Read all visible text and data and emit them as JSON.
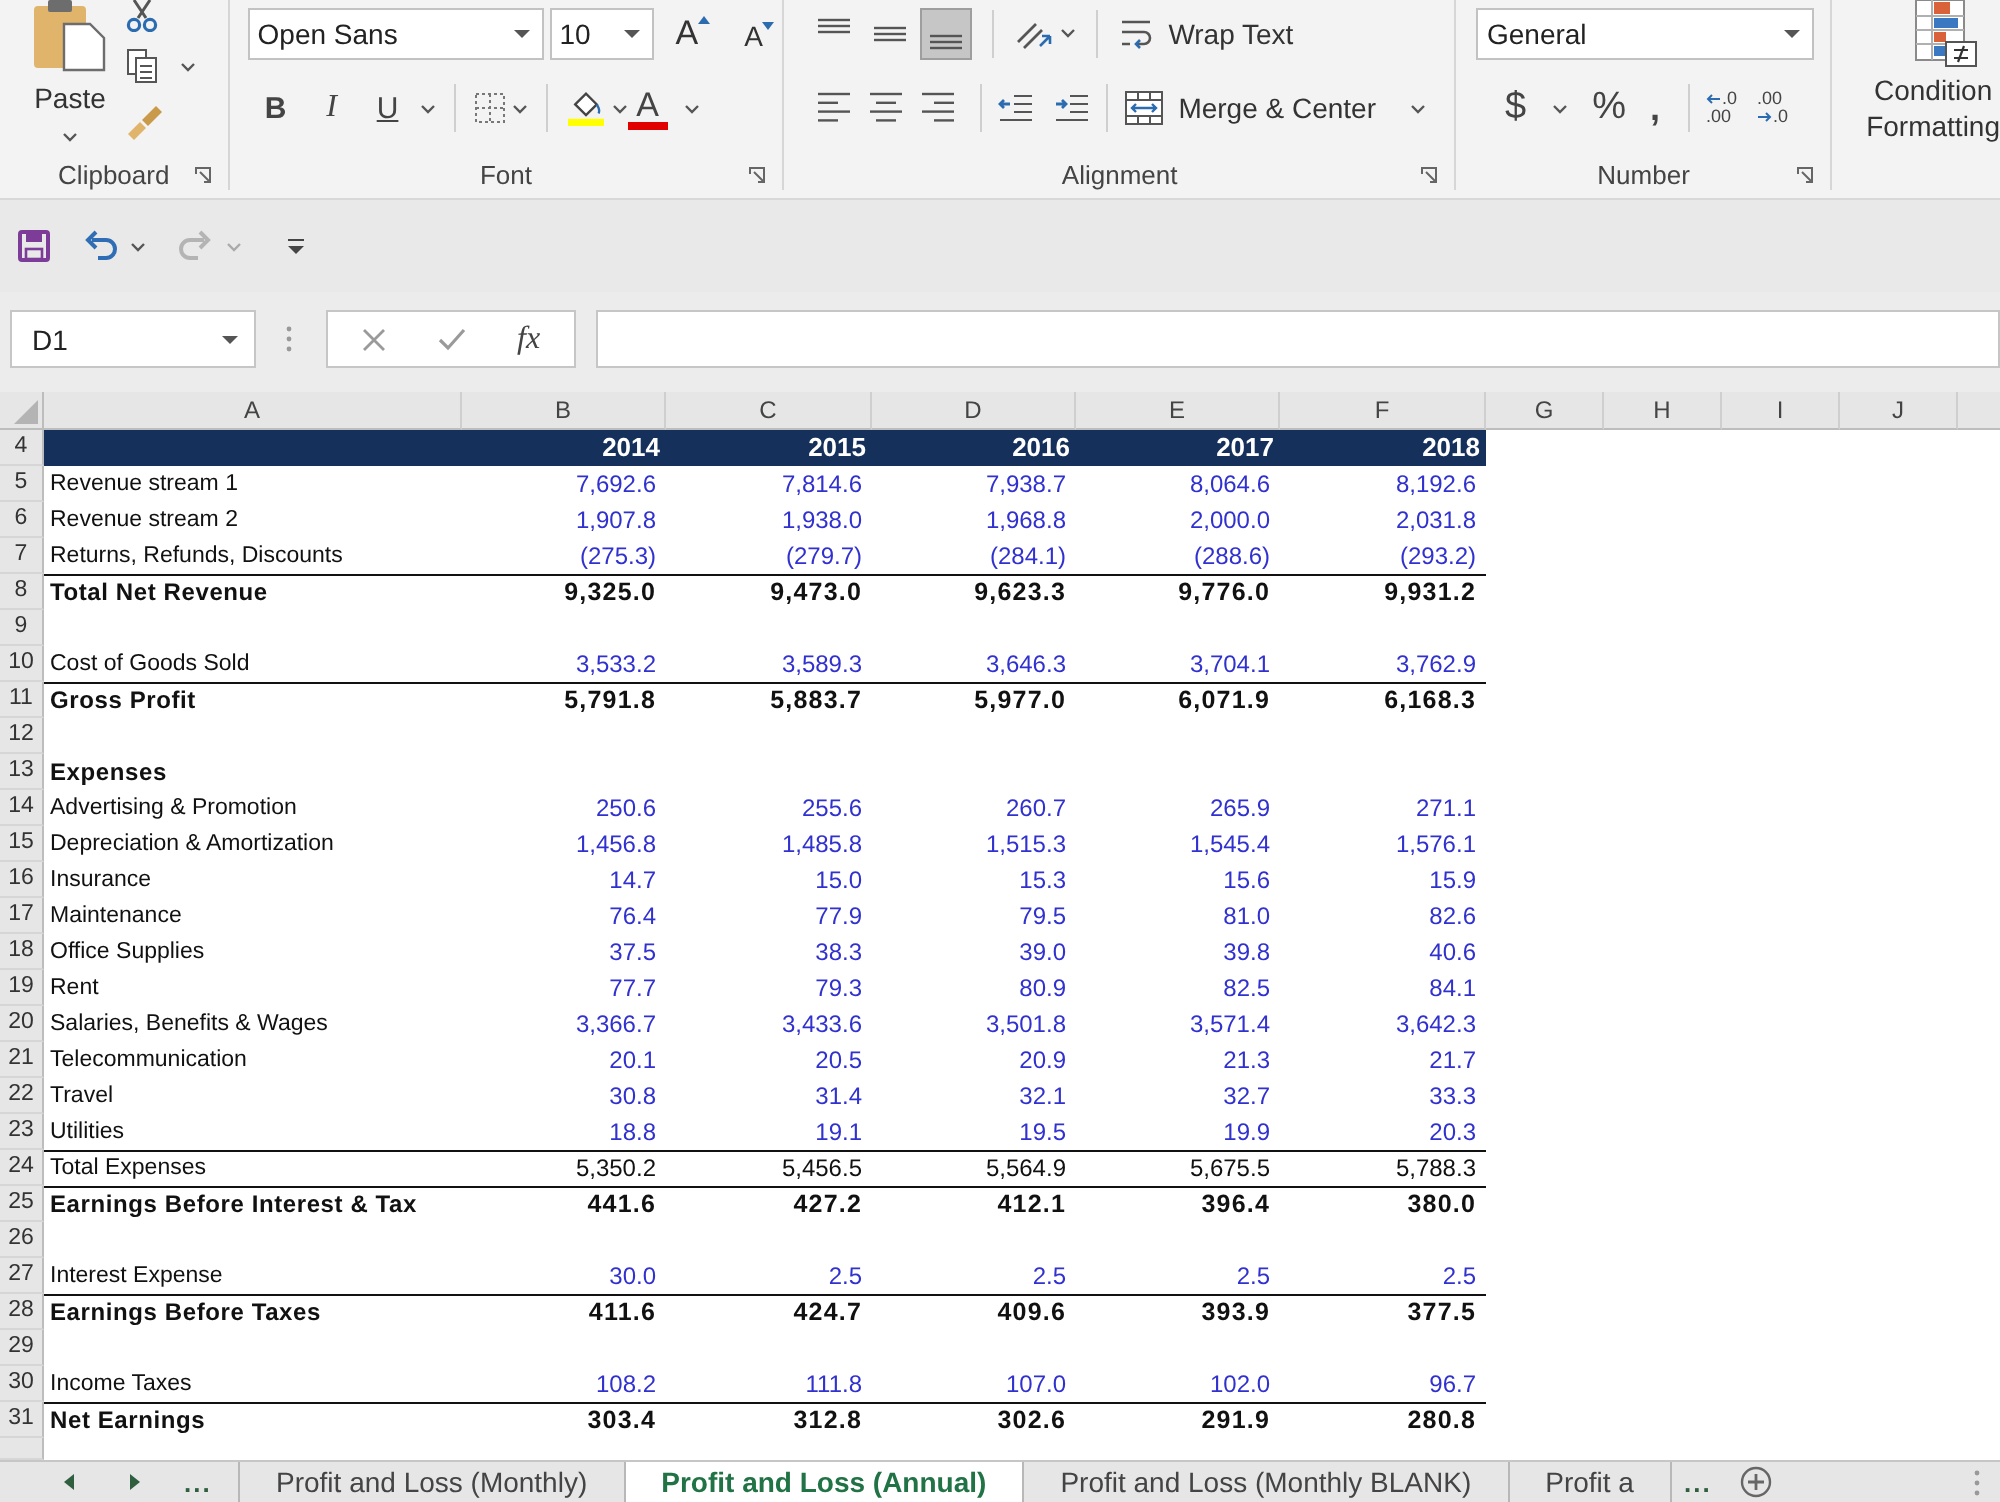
{
  "ribbon": {
    "clipboard": {
      "paste": "Paste",
      "label": "Clipboard"
    },
    "font": {
      "name": "Open Sans",
      "size": "10",
      "grow": "A",
      "shrink": "A",
      "bold": "B",
      "italic": "I",
      "underline": "U",
      "font_color": "A",
      "label": "Font"
    },
    "alignment": {
      "vertical": [
        {
          "kind": "top",
          "selected": false
        },
        {
          "kind": "middle",
          "selected": false
        },
        {
          "kind": "bottom",
          "selected": true
        }
      ],
      "horizontal": [
        {
          "kind": "left",
          "selected": false
        },
        {
          "kind": "center",
          "selected": false
        },
        {
          "kind": "right",
          "selected": false
        }
      ],
      "wrap_text": "Wrap Text",
      "merge": "Merge & Center",
      "label": "Alignment"
    },
    "number": {
      "format": "General",
      "currency": "$",
      "percent": "%",
      "comma": ",",
      "decimals": [
        {
          "kind": "increase",
          "top": ".0",
          "bottom": ".00"
        },
        {
          "kind": "decrease",
          "top": ".00",
          "bottom": ".0"
        }
      ],
      "label": "Number"
    },
    "styles": {
      "conditional_formatting": [
        "Condition",
        "Formatting"
      ]
    }
  },
  "quick_access": {
    "undo": {
      "disabled": false
    },
    "redo": {
      "disabled": true
    }
  },
  "formula_bar": {
    "name_box": "D1",
    "function": "fx"
  },
  "sheet": {
    "columns": [
      "A",
      "B",
      "C",
      "D",
      "E",
      "F",
      "G",
      "H",
      "I",
      "J"
    ],
    "rows": [
      {
        "number": "4",
        "kind": "header",
        "values": [
          "2014",
          "2015",
          "2016",
          "2017",
          "2018"
        ]
      },
      {
        "number": "5",
        "kind": "input",
        "label": "Revenue stream 1",
        "values": [
          "7,692.6",
          "7,814.6",
          "7,938.7",
          "8,064.6",
          "8,192.6"
        ]
      },
      {
        "number": "6",
        "kind": "input",
        "label": "Revenue stream 2",
        "values": [
          "1,907.8",
          "1,938.0",
          "1,968.8",
          "2,000.0",
          "2,031.8"
        ]
      },
      {
        "number": "7",
        "kind": "input",
        "label": "Returns, Refunds, Discounts",
        "values": [
          "(275.3)",
          "(279.7)",
          "(284.1)",
          "(288.6)",
          "(293.2)"
        ]
      },
      {
        "number": "8",
        "kind": "total",
        "label": "Total Net Revenue",
        "values": [
          "9,325.0",
          "9,473.0",
          "9,623.3",
          "9,776.0",
          "9,931.2"
        ]
      },
      {
        "number": "9",
        "kind": "blank"
      },
      {
        "number": "10",
        "kind": "input",
        "label": "Cost of Goods Sold",
        "values": [
          "3,533.2",
          "3,589.3",
          "3,646.3",
          "3,704.1",
          "3,762.9"
        ]
      },
      {
        "number": "11",
        "kind": "total",
        "label": "Gross Profit",
        "values": [
          "5,791.8",
          "5,883.7",
          "5,977.0",
          "6,071.9",
          "6,168.3"
        ]
      },
      {
        "number": "12",
        "kind": "blank"
      },
      {
        "number": "13",
        "kind": "section",
        "label": "Expenses"
      },
      {
        "number": "14",
        "kind": "input",
        "label": "Advertising & Promotion",
        "values": [
          "250.6",
          "255.6",
          "260.7",
          "265.9",
          "271.1"
        ]
      },
      {
        "number": "15",
        "kind": "input",
        "label": "Depreciation & Amortization",
        "values": [
          "1,456.8",
          "1,485.8",
          "1,515.3",
          "1,545.4",
          "1,576.1"
        ]
      },
      {
        "number": "16",
        "kind": "input",
        "label": "Insurance",
        "values": [
          "14.7",
          "15.0",
          "15.3",
          "15.6",
          "15.9"
        ]
      },
      {
        "number": "17",
        "kind": "input",
        "label": "Maintenance",
        "values": [
          "76.4",
          "77.9",
          "79.5",
          "81.0",
          "82.6"
        ]
      },
      {
        "number": "18",
        "kind": "input",
        "label": "Office Supplies",
        "values": [
          "37.5",
          "38.3",
          "39.0",
          "39.8",
          "40.6"
        ]
      },
      {
        "number": "19",
        "kind": "input",
        "label": "Rent",
        "values": [
          "77.7",
          "79.3",
          "80.9",
          "82.5",
          "84.1"
        ]
      },
      {
        "number": "20",
        "kind": "input",
        "label": "Salaries, Benefits & Wages",
        "values": [
          "3,366.7",
          "3,433.6",
          "3,501.8",
          "3,571.4",
          "3,642.3"
        ]
      },
      {
        "number": "21",
        "kind": "input",
        "label": "Telecommunication",
        "values": [
          "20.1",
          "20.5",
          "20.9",
          "21.3",
          "21.7"
        ]
      },
      {
        "number": "22",
        "kind": "input",
        "label": "Travel",
        "values": [
          "30.8",
          "31.4",
          "32.1",
          "32.7",
          "33.3"
        ]
      },
      {
        "number": "23",
        "kind": "input",
        "label": "Utilities",
        "values": [
          "18.8",
          "19.1",
          "19.5",
          "19.9",
          "20.3"
        ]
      },
      {
        "number": "24",
        "kind": "subtotal",
        "label": "Total Expenses",
        "values": [
          "5,350.2",
          "5,456.5",
          "5,564.9",
          "5,675.5",
          "5,788.3"
        ]
      },
      {
        "number": "25",
        "kind": "total",
        "label": "Earnings Before Interest & Tax",
        "values": [
          "441.6",
          "427.2",
          "412.1",
          "396.4",
          "380.0"
        ]
      },
      {
        "number": "26",
        "kind": "blank"
      },
      {
        "number": "27",
        "kind": "input",
        "label": "Interest Expense",
        "values": [
          "30.0",
          "2.5",
          "2.5",
          "2.5",
          "2.5"
        ]
      },
      {
        "number": "28",
        "kind": "total",
        "label": "Earnings Before Taxes",
        "values": [
          "411.6",
          "424.7",
          "409.6",
          "393.9",
          "377.5"
        ]
      },
      {
        "number": "29",
        "kind": "blank"
      },
      {
        "number": "30",
        "kind": "input",
        "label": "Income Taxes",
        "values": [
          "108.2",
          "111.8",
          "107.0",
          "102.0",
          "96.7"
        ]
      },
      {
        "number": "31",
        "kind": "total",
        "label": "Net Earnings",
        "values": [
          "303.4",
          "312.8",
          "302.6",
          "291.9",
          "280.8"
        ]
      }
    ]
  },
  "sheet_tabs": {
    "more_left": "...",
    "tabs": [
      {
        "label": "Profit and Loss (Monthly)",
        "selected": false
      },
      {
        "label": "Profit and Loss (Annual)",
        "selected": true
      },
      {
        "label": "Profit and Loss (Monthly BLANK)",
        "selected": false
      },
      {
        "label": "Profit a",
        "selected": false
      }
    ],
    "more_right": "..."
  }
}
